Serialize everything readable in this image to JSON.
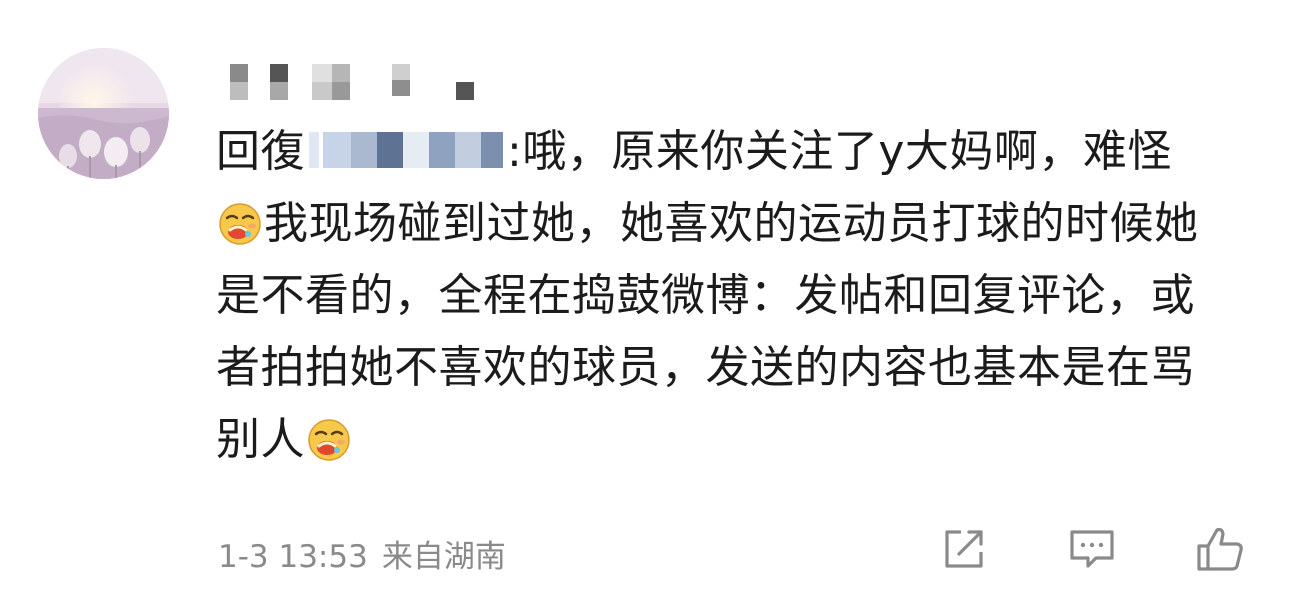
{
  "comment": {
    "reply_prefix": "回復",
    "text_part1": ":哦，原来你关注了y大妈啊，难怪",
    "text_part2": "我现场碰到过她，她喜欢的运动员打球的时候她是不看的，全程在捣鼓微博：发帖和回复评论，或者拍拍她不喜欢的球员，发送的内容也基本是在骂别人"
  },
  "footer": {
    "timestamp": "1-3 13:53",
    "location": "来自湖南"
  },
  "icons": {
    "emoji": "drooling-face-emoji",
    "share": "share-icon",
    "reply": "comment-icon",
    "like": "thumbs-up-icon"
  }
}
